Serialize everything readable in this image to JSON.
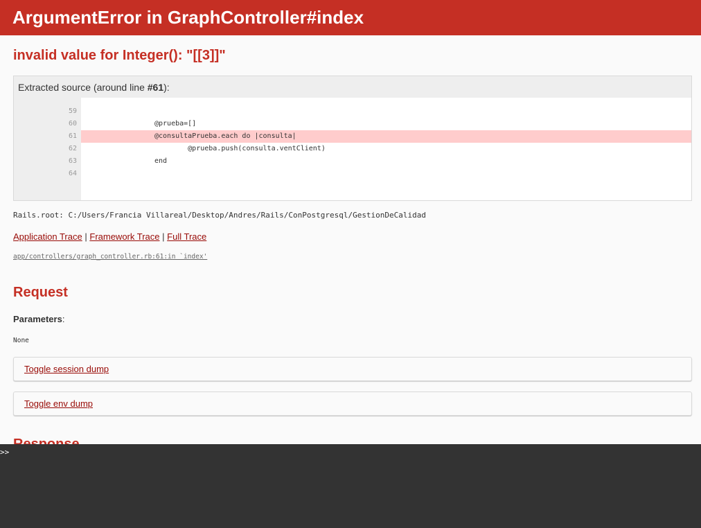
{
  "header": {
    "title": "ArgumentError in GraphController#index"
  },
  "error_message": "invalid value for Integer(): \"[[3]]\"",
  "source": {
    "caption_prefix": "Extracted source (around line ",
    "caption_line": "#61",
    "caption_suffix": "):",
    "lines": [
      {
        "num": "59",
        "code": ""
      },
      {
        "num": "60",
        "code": "@prueba=[]"
      },
      {
        "num": "61",
        "code": "@consultaPrueba.each do |consulta|",
        "highlighted": true
      },
      {
        "num": "62",
        "code": "        @prueba.push(consulta.ventClient)"
      },
      {
        "num": "63",
        "code": "end"
      },
      {
        "num": "64",
        "code": ""
      }
    ]
  },
  "rails_root": "Rails.root: C:/Users/Francia Villareal/Desktop/Andres/Rails/ConPostgresql/GestionDeCalidad",
  "traces": {
    "application": "Application Trace",
    "framework": "Framework Trace",
    "full": "Full Trace",
    "separator": "|"
  },
  "trace_line": "app/controllers/graph_controller.rb:61:in `index'",
  "request": {
    "heading": "Request",
    "params_label": "Parameters",
    "params_colon": ":",
    "params_value": "None",
    "toggle_session": "Toggle session dump",
    "toggle_env": "Toggle env dump"
  },
  "response": {
    "heading": "Response"
  },
  "console": {
    "prompt": ">>"
  },
  "colors": {
    "accent": "#C52F24",
    "link": "#980905",
    "highlight": "#FFCCCC",
    "console_bg": "#333333"
  }
}
